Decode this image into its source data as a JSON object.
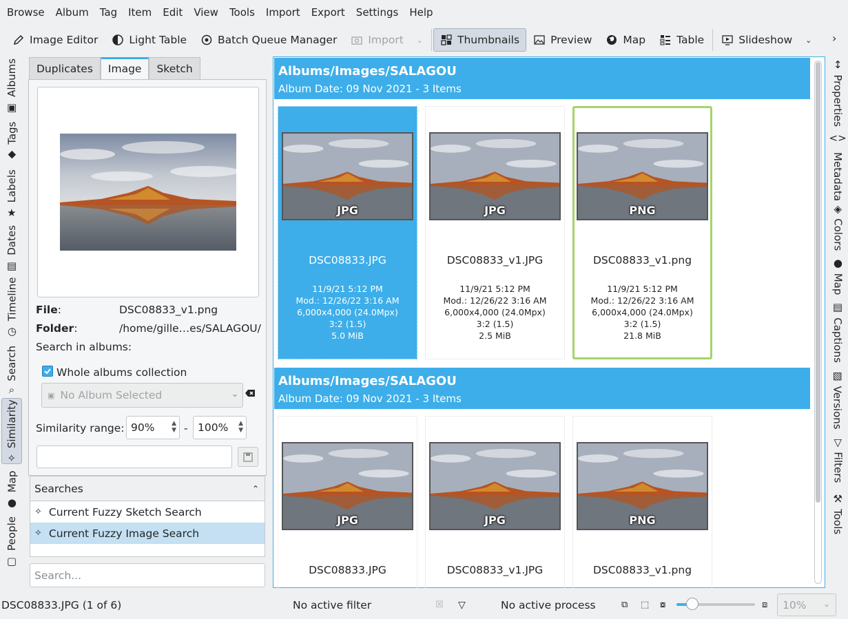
{
  "menu": [
    "Browse",
    "Album",
    "Tag",
    "Item",
    "Edit",
    "View",
    "Tools",
    "Import",
    "Export",
    "Settings",
    "Help"
  ],
  "toolbar": {
    "image_editor": "Image Editor",
    "light_table": "Light Table",
    "batch_queue": "Batch Queue Manager",
    "import": "Import",
    "thumbnails": "Thumbnails",
    "preview": "Preview",
    "map": "Map",
    "table": "Table",
    "slideshow": "Slideshow"
  },
  "left_tabs": [
    "Albums",
    "Tags",
    "Labels",
    "Dates",
    "Timeline",
    "Search",
    "Similarity",
    "Map",
    "People"
  ],
  "right_tabs": [
    "Properties",
    "Metadata",
    "Colors",
    "Map",
    "Captions",
    "Versions",
    "Filters",
    "Tools"
  ],
  "panel": {
    "tabs": [
      "Duplicates",
      "Image",
      "Sketch"
    ],
    "file_label": "File",
    "file_value": "DSC08833_v1.png",
    "folder_label": "Folder",
    "folder_value": "/home/gille…es/SALAGOU/",
    "search_in_albums": "Search in albums:",
    "whole_albums": "Whole albums collection",
    "no_album": "No Album Selected",
    "similarity_range": "Similarity range:",
    "range_min": "90%",
    "range_sep": "-",
    "range_max": "100%"
  },
  "searches": {
    "header": "Searches",
    "items": [
      "Current Fuzzy Sketch Search",
      "Current Fuzzy Image Search"
    ],
    "placeholder": "Search..."
  },
  "groups": [
    {
      "title": "Albums/Images/SALAGOU",
      "subtitle": "Album Date: 09 Nov 2021 - 3 Items",
      "items": [
        {
          "format": "JPG",
          "name": "DSC08833.JPG",
          "date": "11/9/21 5:12 PM",
          "mod": "Mod.: 12/26/22 3:16 AM",
          "dims": "6,000x4,000 (24.0Mpx)",
          "ratio": "3:2 (1.5)",
          "size": "5.0 MiB"
        },
        {
          "format": "JPG",
          "name": "DSC08833_v1.JPG",
          "date": "11/9/21 5:12 PM",
          "mod": "Mod.: 12/26/22 3:16 AM",
          "dims": "6,000x4,000 (24.0Mpx)",
          "ratio": "3:2 (1.5)",
          "size": "2.5 MiB"
        },
        {
          "format": "PNG",
          "name": "DSC08833_v1.png",
          "date": "11/9/21 5:12 PM",
          "mod": "Mod.: 12/26/22 3:16 AM",
          "dims": "6,000x4,000 (24.0Mpx)",
          "ratio": "3:2 (1.5)",
          "size": "21.8 MiB"
        }
      ]
    },
    {
      "title": "Albums/Images/SALAGOU",
      "subtitle": "Album Date: 09 Nov 2021 - 3 Items",
      "items": [
        {
          "format": "JPG",
          "name": "DSC08833.JPG"
        },
        {
          "format": "JPG",
          "name": "DSC08833_v1.JPG"
        },
        {
          "format": "PNG",
          "name": "DSC08833_v1.png"
        }
      ]
    }
  ],
  "status": {
    "item": "DSC08833.JPG (1 of 6)",
    "filter": "No active filter",
    "process": "No active process",
    "zoom": "10%",
    "zoom_slider_fraction": 0.2
  },
  "colors": {
    "accent": "#3daee9",
    "current_frame": "#a6d36a"
  }
}
